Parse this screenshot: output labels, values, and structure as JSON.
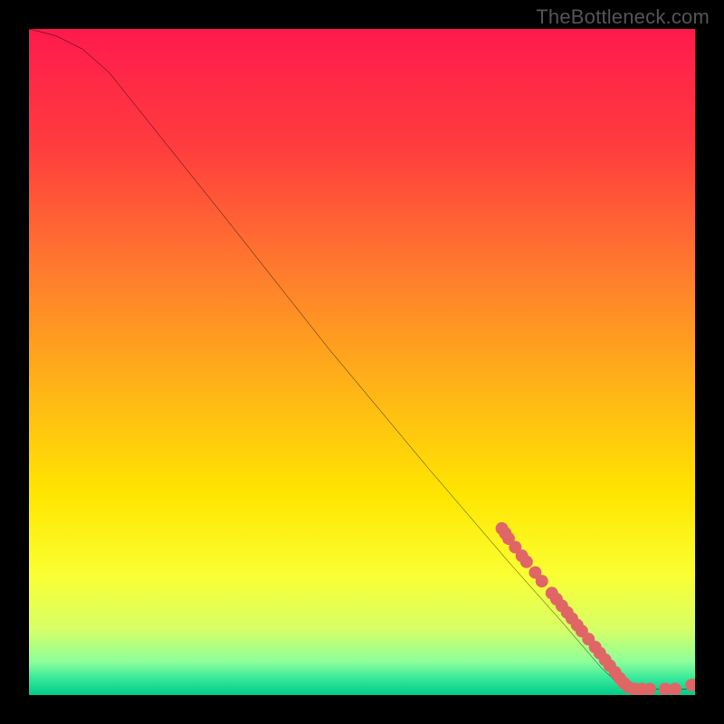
{
  "attribution": "TheBottleneck.com",
  "chart_data": {
    "type": "line",
    "title": "",
    "xlabel": "",
    "ylabel": "",
    "xlim": [
      0,
      100
    ],
    "ylim": [
      0,
      100
    ],
    "background_gradient_stops": [
      {
        "offset": 0.0,
        "color": "#ff1a4d"
      },
      {
        "offset": 0.18,
        "color": "#ff3d3d"
      },
      {
        "offset": 0.36,
        "color": "#ff7a2e"
      },
      {
        "offset": 0.54,
        "color": "#ffb417"
      },
      {
        "offset": 0.7,
        "color": "#ffe600"
      },
      {
        "offset": 0.82,
        "color": "#faff33"
      },
      {
        "offset": 0.9,
        "color": "#d8ff66"
      },
      {
        "offset": 0.95,
        "color": "#8dff9a"
      },
      {
        "offset": 0.975,
        "color": "#37e89b"
      },
      {
        "offset": 1.0,
        "color": "#00cc88"
      }
    ],
    "series": [
      {
        "name": "bottleneck-curve",
        "type": "line",
        "color": "#000000",
        "width": 2,
        "points": [
          {
            "x": 0,
            "y": 100
          },
          {
            "x": 4,
            "y": 99
          },
          {
            "x": 8,
            "y": 97
          },
          {
            "x": 12,
            "y": 93.5
          },
          {
            "x": 18,
            "y": 86
          },
          {
            "x": 30,
            "y": 71
          },
          {
            "x": 45,
            "y": 52
          },
          {
            "x": 60,
            "y": 34
          },
          {
            "x": 72,
            "y": 20
          },
          {
            "x": 80,
            "y": 11
          },
          {
            "x": 86,
            "y": 4
          },
          {
            "x": 89,
            "y": 1.2
          },
          {
            "x": 90,
            "y": 0.9
          },
          {
            "x": 100,
            "y": 0.9
          }
        ]
      },
      {
        "name": "bottleneck-markers",
        "type": "scatter",
        "color": "#e06666",
        "radius": 7,
        "points": [
          {
            "x": 71,
            "y": 25
          },
          {
            "x": 71.5,
            "y": 24.3
          },
          {
            "x": 72,
            "y": 23.5
          },
          {
            "x": 73,
            "y": 22.2
          },
          {
            "x": 74,
            "y": 20.9
          },
          {
            "x": 74.7,
            "y": 20
          },
          {
            "x": 76,
            "y": 18.4
          },
          {
            "x": 77,
            "y": 17.1
          },
          {
            "x": 78.5,
            "y": 15.3
          },
          {
            "x": 79.2,
            "y": 14.4
          },
          {
            "x": 80,
            "y": 13.4
          },
          {
            "x": 80.8,
            "y": 12.4
          },
          {
            "x": 81.5,
            "y": 11.5
          },
          {
            "x": 82.3,
            "y": 10.5
          },
          {
            "x": 83,
            "y": 9.6
          },
          {
            "x": 84,
            "y": 8.4
          },
          {
            "x": 85,
            "y": 7.2
          },
          {
            "x": 85.7,
            "y": 6.3
          },
          {
            "x": 86.5,
            "y": 5.3
          },
          {
            "x": 87.2,
            "y": 4.4
          },
          {
            "x": 88,
            "y": 3.4
          },
          {
            "x": 88.7,
            "y": 2.5
          },
          {
            "x": 89.3,
            "y": 1.8
          },
          {
            "x": 90,
            "y": 1.2
          },
          {
            "x": 91,
            "y": 0.9
          },
          {
            "x": 92,
            "y": 0.9
          },
          {
            "x": 93.2,
            "y": 0.9
          },
          {
            "x": 95.5,
            "y": 0.9
          },
          {
            "x": 97,
            "y": 0.9
          },
          {
            "x": 99.5,
            "y": 1.5
          }
        ]
      }
    ]
  }
}
